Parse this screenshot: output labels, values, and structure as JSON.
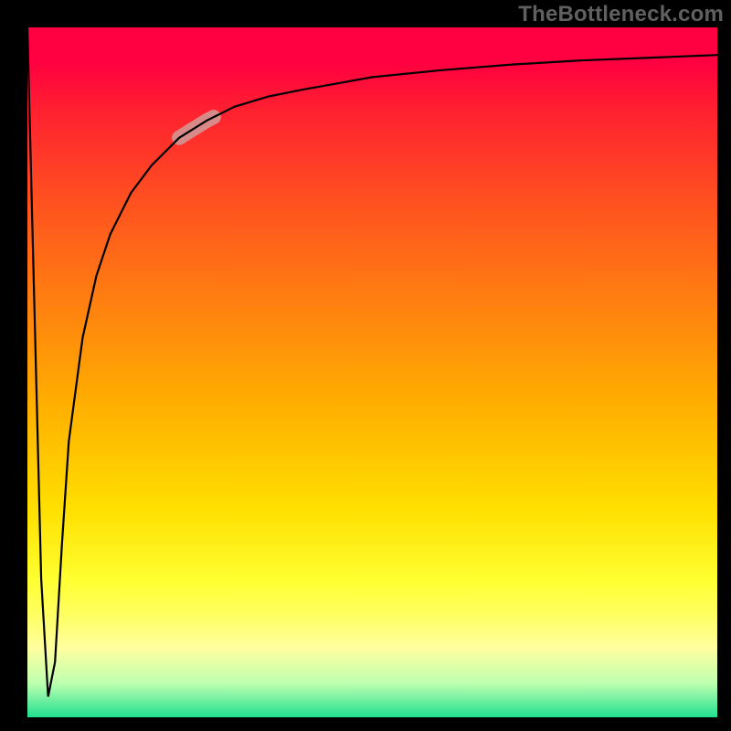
{
  "watermark": "TheBottleneck.com",
  "chart_data": {
    "type": "line",
    "title": "",
    "xlabel": "",
    "ylabel": "",
    "xlim": [
      0,
      100
    ],
    "ylim": [
      0,
      100
    ],
    "grid": false,
    "series": [
      {
        "name": "bottleneck-curve",
        "x": [
          0,
          1,
          2,
          3,
          4,
          5,
          6,
          8,
          10,
          12,
          15,
          18,
          22,
          26,
          30,
          35,
          40,
          50,
          60,
          70,
          80,
          90,
          100
        ],
        "y": [
          100,
          60,
          20,
          3,
          8,
          25,
          40,
          55,
          64,
          70,
          76,
          80,
          84,
          86.5,
          88.5,
          90,
          91,
          92.8,
          93.8,
          94.6,
          95.2,
          95.6,
          96
        ]
      }
    ],
    "highlight_segment": {
      "series": "bottleneck-curve",
      "x_start": 22,
      "x_end": 27,
      "color": "#d88a88",
      "width": 16
    },
    "gradient_background": {
      "stops": [
        {
          "pos": 0,
          "color": "#ff0040"
        },
        {
          "pos": 5,
          "color": "#ff0040"
        },
        {
          "pos": 12,
          "color": "#ff2030"
        },
        {
          "pos": 25,
          "color": "#ff5020"
        },
        {
          "pos": 40,
          "color": "#ff8010"
        },
        {
          "pos": 55,
          "color": "#ffb000"
        },
        {
          "pos": 70,
          "color": "#ffe000"
        },
        {
          "pos": 80,
          "color": "#ffff30"
        },
        {
          "pos": 85,
          "color": "#ffff60"
        },
        {
          "pos": 90,
          "color": "#ffffa0"
        },
        {
          "pos": 95,
          "color": "#c0ffb0"
        },
        {
          "pos": 100,
          "color": "#20e090"
        }
      ]
    }
  }
}
